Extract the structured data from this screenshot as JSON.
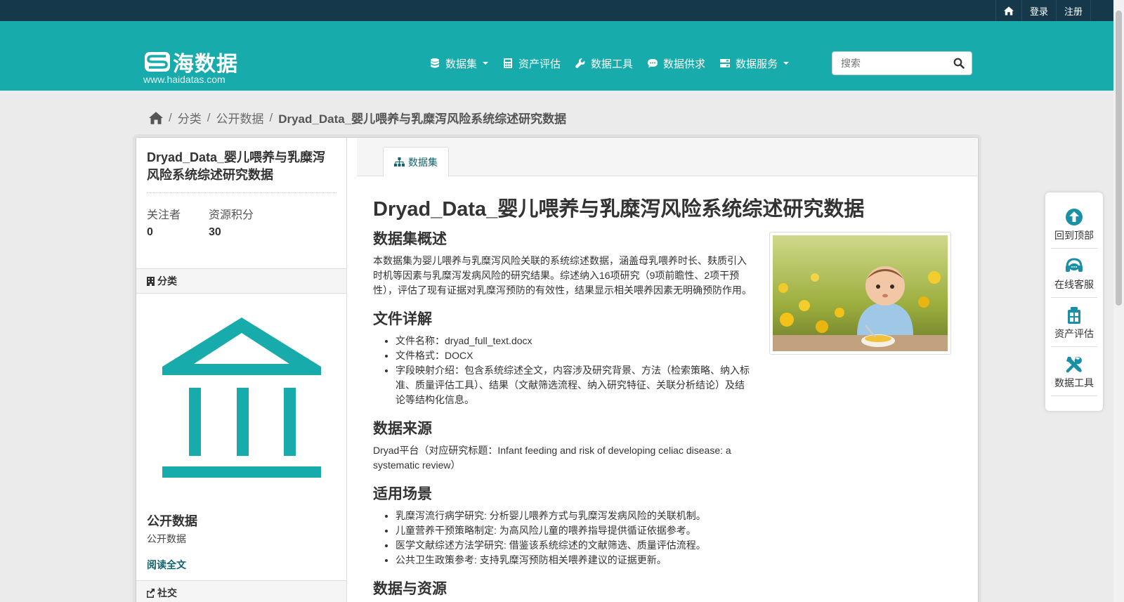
{
  "account": {
    "home_icon": "home-icon",
    "login": "登录",
    "register": "注册"
  },
  "brand": {
    "name": "海数据",
    "url": "www.haidatas.com"
  },
  "nav": [
    {
      "label": "数据集",
      "icon": "database-icon",
      "dropdown": true
    },
    {
      "label": "资产评估",
      "icon": "calculator-icon",
      "dropdown": false
    },
    {
      "label": "数据工具",
      "icon": "wrench-icon",
      "dropdown": false
    },
    {
      "label": "数据供求",
      "icon": "comment-icon",
      "dropdown": false
    },
    {
      "label": "数据服务",
      "icon": "server-icon",
      "dropdown": true
    }
  ],
  "search": {
    "placeholder": "搜索"
  },
  "breadcrumb": {
    "items": [
      "分类",
      "公开数据"
    ],
    "current": "Dryad_Data_婴儿喂养与乳糜泻风险系统综述研究数据"
  },
  "sidebar": {
    "title": "Dryad_Data_婴儿喂养与乳糜泻风险系统综述研究数据",
    "followers_label": "关注者",
    "followers_value": "0",
    "points_label": "资源积分",
    "points_value": "30",
    "category_head": "分类",
    "org_title": "公开数据",
    "org_desc": "公开数据",
    "read_more": "阅读全文",
    "social_head": "社交"
  },
  "tab": {
    "label": "数据集"
  },
  "article": {
    "title": "Dryad_Data_婴儿喂养与乳糜泻风险系统综述研究数据",
    "overview_head": "数据集概述",
    "overview_text": "本数据集为婴儿喂养与乳糜泻风险关联的系统综述数据，涵盖母乳喂养时长、麸质引入时机等因素与乳糜泻发病风险的研究结果。综述纳入16项研究（9项前瞻性、2项干预性），评估了现有证据对乳糜泻预防的有效性，结果显示相关喂养因素无明确预防作用。",
    "file_head": "文件详解",
    "file_items": [
      "文件名称：dryad_full_text.docx",
      "文件格式：DOCX",
      "字段映射介绍：包含系统综述全文，内容涉及研究背景、方法（检索策略、纳入标准、质量评估工具）、结果（文献筛选流程、纳入研究特征、关联分析结论）及结论等结构化信息。"
    ],
    "source_head": "数据来源",
    "source_text": "Dryad平台（对应研究标题：Infant feeding and risk of developing celiac disease: a systematic review）",
    "usage_head": "适用场景",
    "usage_items": [
      "乳糜泻流行病学研究: 分析婴儿喂养方式与乳糜泻发病风险的关联机制。",
      "儿童营养干预策略制定: 为高风险儿童的喂养指导提供循证依据参考。",
      "医学文献综述方法学研究: 借鉴该系统综述的文献筛选、质量评估流程。",
      "公共卫生政策参考: 支持乳糜泻预防相关喂养建议的证据更新。"
    ],
    "next_head": "数据与资源"
  },
  "rail": [
    {
      "label": "回到顶部",
      "icon": "arrow-up-circle-icon"
    },
    {
      "label": "在线客服",
      "icon": "headset-icon"
    },
    {
      "label": "资产评估",
      "icon": "clipboard-icon"
    },
    {
      "label": "数据工具",
      "icon": "tools-icon"
    }
  ],
  "colors": {
    "topbar": "#15384a",
    "brand": "#18abab",
    "link": "#12636e",
    "rail_icon": "#1a8fa8"
  }
}
